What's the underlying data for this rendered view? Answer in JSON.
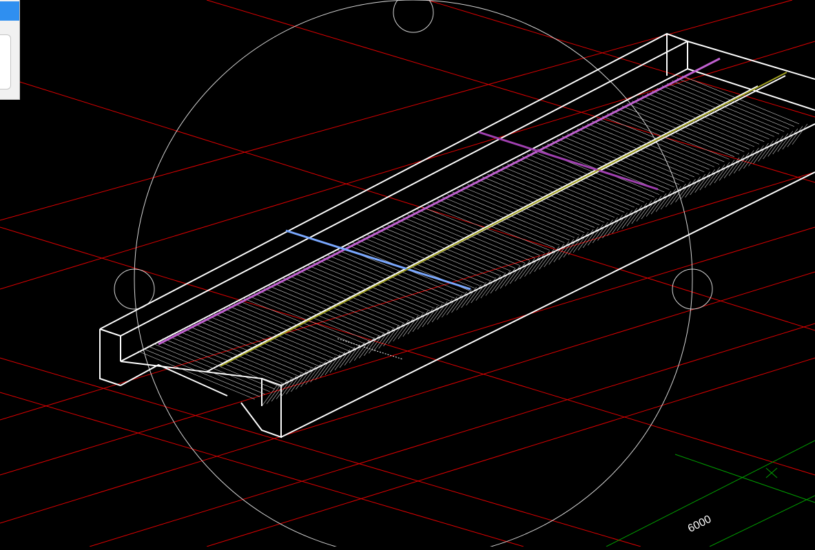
{
  "viewport": {
    "background": "#000000",
    "grid_color_red": "#ff0000",
    "grid_color_green": "#00a000",
    "model_color": "#ffffff",
    "highlight_colors": {
      "purple": "#b040c0",
      "blue": "#7aa8ff",
      "yellow": "#b0b030"
    },
    "dimension_label": "6000"
  },
  "side_panel": {
    "header_color": "#2f8ff0"
  }
}
